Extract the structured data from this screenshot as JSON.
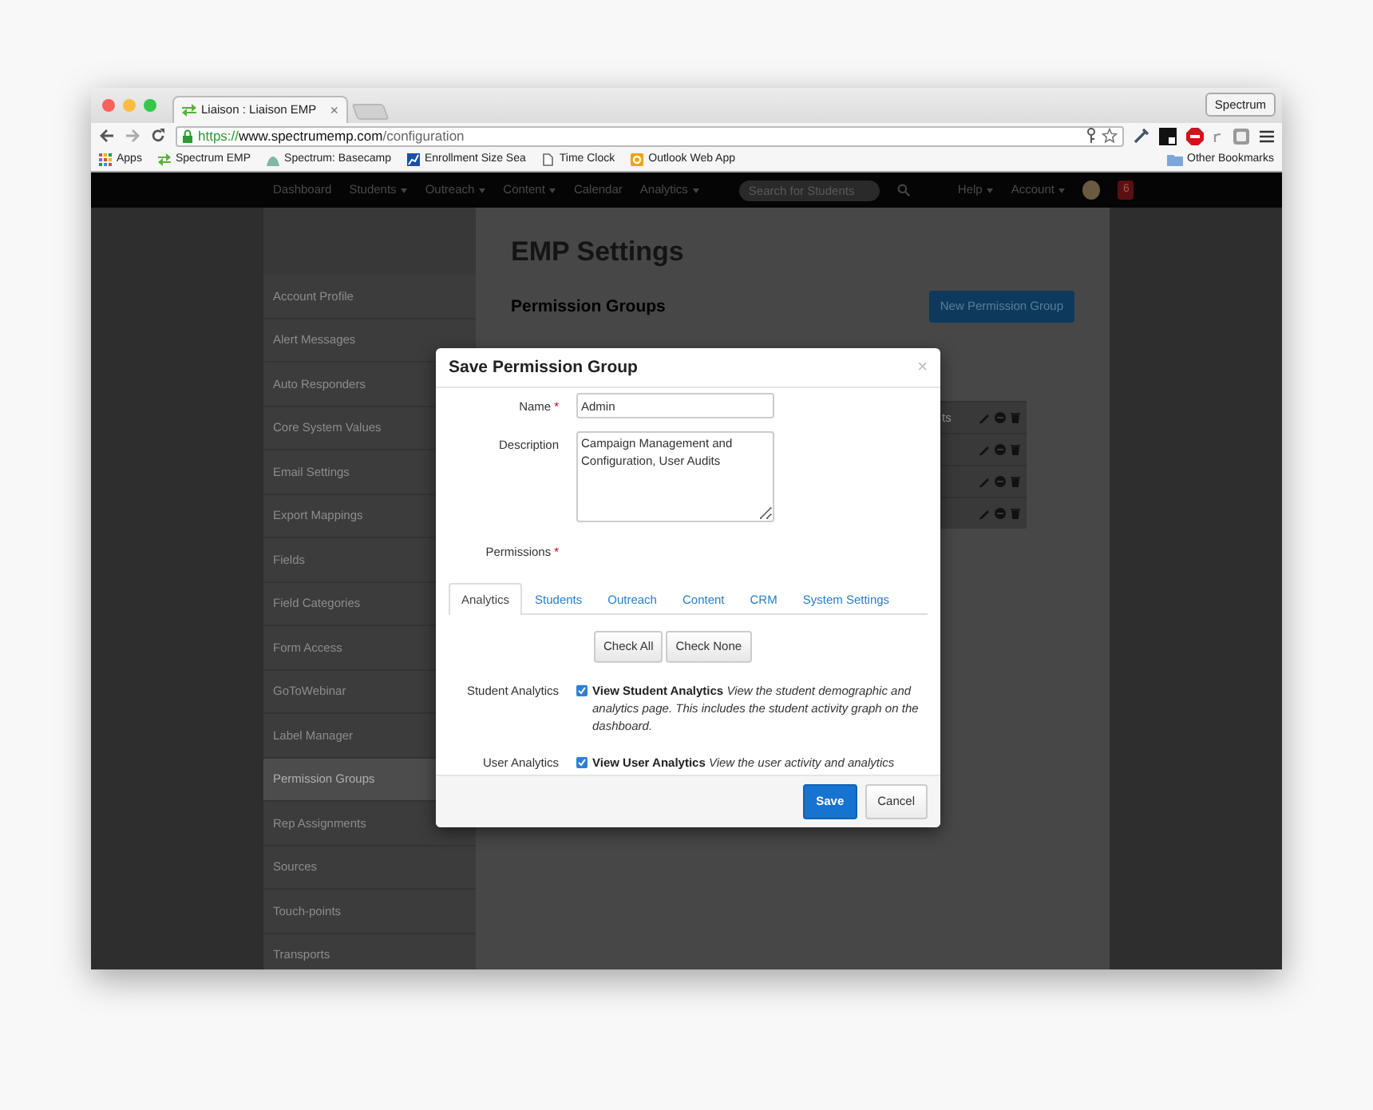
{
  "browser": {
    "tab_title": "Liaison : Liaison EMP",
    "tab_close": "×",
    "profile_button": "Spectrum",
    "url": {
      "scheme": "https://",
      "host": "www.spectrumemp.com",
      "path": "/configuration"
    },
    "bookmarks": [
      {
        "label": "Apps",
        "kind": "apps"
      },
      {
        "label": "Spectrum EMP",
        "kind": "arrows"
      },
      {
        "label": "Spectrum: Basecamp",
        "kind": "hill"
      },
      {
        "label": "Enrollment Size Sea",
        "kind": "chart"
      },
      {
        "label": "Time Clock",
        "kind": "page"
      },
      {
        "label": "Outlook Web App",
        "kind": "outlook"
      }
    ],
    "other_bookmarks": "Other Bookmarks"
  },
  "navbar": {
    "items": [
      {
        "label": "Dashboard",
        "dropdown": false
      },
      {
        "label": "Students",
        "dropdown": true
      },
      {
        "label": "Outreach",
        "dropdown": true
      },
      {
        "label": "Content",
        "dropdown": true
      },
      {
        "label": "Calendar",
        "dropdown": false
      },
      {
        "label": "Analytics",
        "dropdown": true
      }
    ],
    "search": {
      "placeholder": "Search for Students"
    },
    "right_items": [
      {
        "label": "Help",
        "dropdown": true
      },
      {
        "label": "Account",
        "dropdown": true
      }
    ],
    "badge": "6"
  },
  "page": {
    "title": "EMP Settings",
    "section_title": "Permission Groups",
    "new_button": "New Permission Group",
    "sidebar": [
      {
        "label": "Account Profile",
        "selected": false
      },
      {
        "label": "Alert Messages",
        "selected": false
      },
      {
        "label": "Auto Responders",
        "selected": false
      },
      {
        "label": "Core System Values",
        "selected": false
      },
      {
        "label": "Email Settings",
        "selected": false
      },
      {
        "label": "Export Mappings",
        "selected": false
      },
      {
        "label": "Fields",
        "selected": false
      },
      {
        "label": "Field Categories",
        "selected": false
      },
      {
        "label": "Form Access",
        "selected": false
      },
      {
        "label": "GoToWebinar",
        "selected": false
      },
      {
        "label": "Label Manager",
        "selected": false
      },
      {
        "label": "Permission Groups",
        "selected": true
      },
      {
        "label": "Rep Assignments",
        "selected": false
      },
      {
        "label": "Sources",
        "selected": false
      },
      {
        "label": "Touch-points",
        "selected": false
      },
      {
        "label": "Transports",
        "selected": false
      }
    ],
    "rows": [
      {
        "name": "ts"
      },
      {},
      {},
      {}
    ]
  },
  "modal": {
    "title": "Save Permission Group",
    "close": "×",
    "name": {
      "label": "Name",
      "required_mark": "*",
      "value": "Admin"
    },
    "description": {
      "label": "Description",
      "value": "Campaign Management and Configuration, User Audits"
    },
    "permissions": {
      "label": "Permissions",
      "required_mark": "*"
    },
    "tabs": [
      {
        "label": "Analytics",
        "selected": true
      },
      {
        "label": "Students",
        "selected": false
      },
      {
        "label": "Outreach",
        "selected": false
      },
      {
        "label": "Content",
        "selected": false
      },
      {
        "label": "CRM",
        "selected": false
      },
      {
        "label": "System Settings",
        "selected": false
      }
    ],
    "check_buttons": [
      "Check All",
      "Check None"
    ],
    "items": [
      {
        "group": "Student Analytics",
        "title": "View Student Analytics",
        "description": "View the student demographic and analytics page. This includes the student activity graph on the dashboard.",
        "checked": true
      },
      {
        "group": "User Analytics",
        "title": "View User Analytics",
        "description": "View the user activity and analytics",
        "checked": true
      }
    ],
    "footer_buttons": [
      {
        "label": "Save",
        "kind": "primary"
      },
      {
        "label": "Cancel",
        "kind": "default"
      }
    ]
  }
}
